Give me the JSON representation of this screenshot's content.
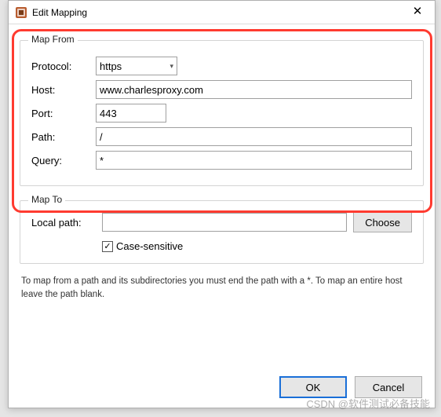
{
  "window": {
    "title": "Edit Mapping"
  },
  "groups": {
    "mapfrom_legend": "Map From",
    "mapto_legend": "Map To"
  },
  "labels": {
    "protocol": "Protocol:",
    "host": "Host:",
    "port": "Port:",
    "path": "Path:",
    "query": "Query:",
    "localpath": "Local path:",
    "choose": "Choose",
    "casesensitive": "Case-sensitive"
  },
  "values": {
    "protocol": "https",
    "host": "www.charlesproxy.com",
    "port": "443",
    "path": "/",
    "query": "*",
    "localpath": "",
    "casesensitive_checked": "✓"
  },
  "hint": "To map from a path and its subdirectories you must end the path with a *. To map an entire host leave the path blank.",
  "buttons": {
    "ok": "OK",
    "cancel": "Cancel"
  },
  "watermark": "CSDN @软件测试必备技能"
}
